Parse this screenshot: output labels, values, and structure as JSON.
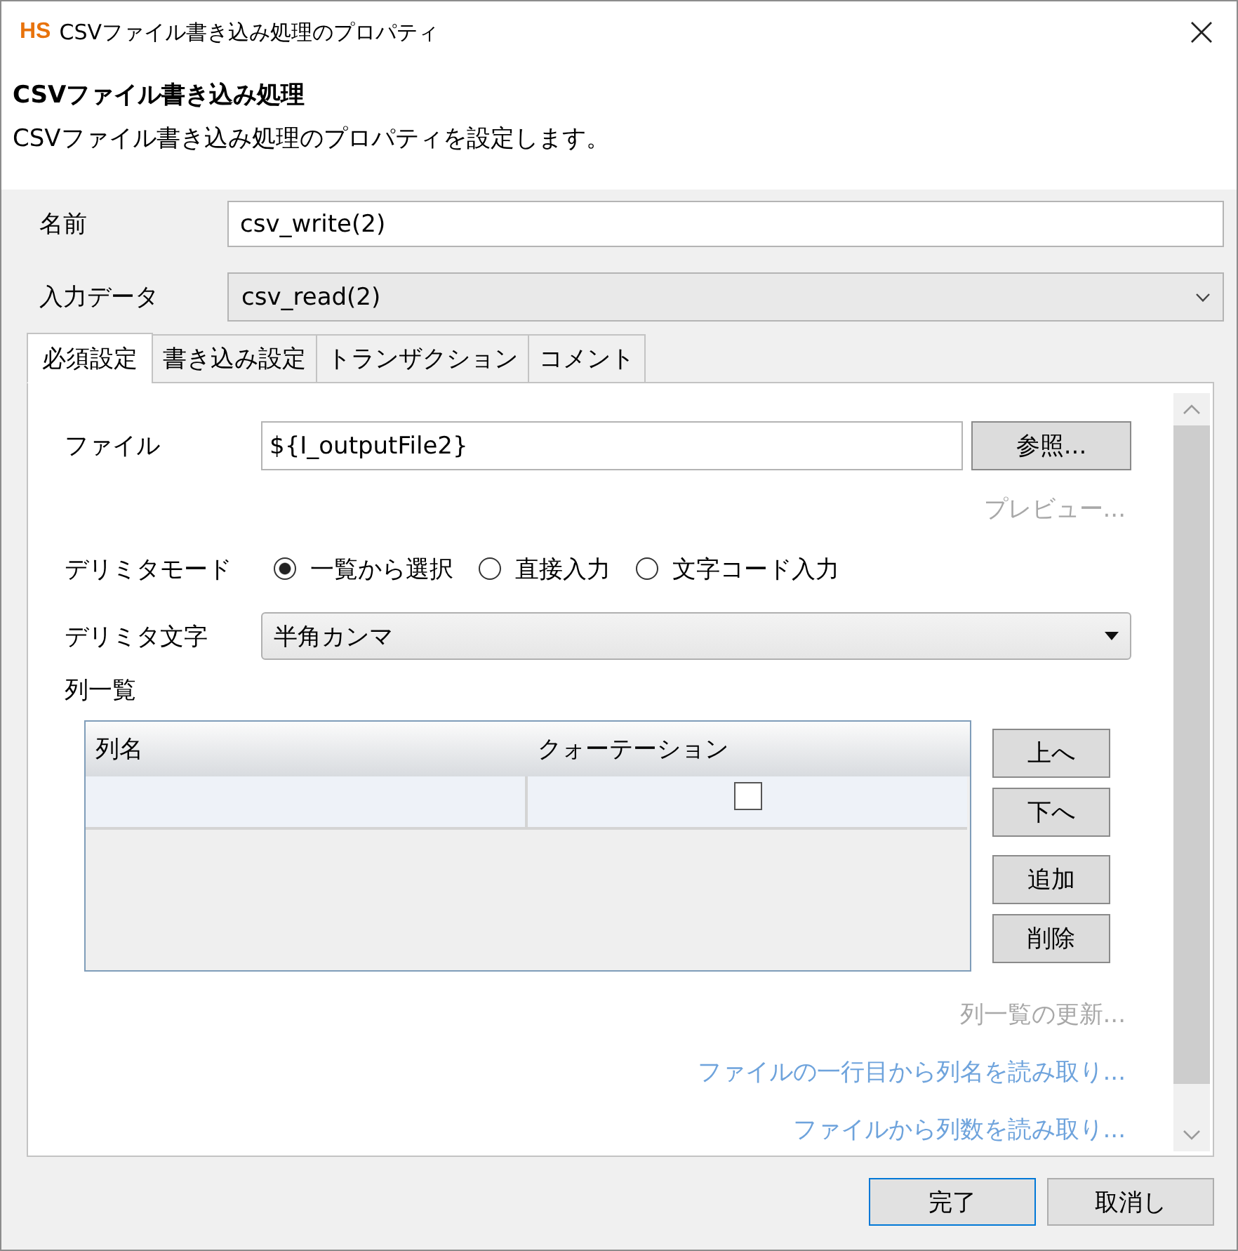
{
  "window": {
    "logo": "HS",
    "title": "CSVファイル書き込み処理のプロパティ"
  },
  "header": {
    "title": "CSVファイル書き込み処理",
    "description": "CSVファイル書き込み処理のプロパティを設定します。"
  },
  "fields": [
    {
      "kind": "text",
      "label": "名前",
      "value": "csv_write(2)"
    },
    {
      "kind": "dropdown",
      "label": "入力データ",
      "value": "csv_read(2)"
    }
  ],
  "tabs": [
    {
      "label": "必須設定",
      "selected": true
    },
    {
      "label": "書き込み設定",
      "selected": false
    },
    {
      "label": "トランザクション",
      "selected": false
    },
    {
      "label": "コメント",
      "selected": false
    }
  ],
  "required_settings": {
    "file": {
      "label": "ファイル",
      "value": "${I_outputFile2}",
      "button": "参照..."
    },
    "preview_link": {
      "label": "プレビュー...",
      "disabled": true
    },
    "delimiter_mode": {
      "label": "デリミタモード",
      "options": [
        {
          "label": "一覧から選択",
          "selected": true
        },
        {
          "label": "直接入力",
          "selected": false
        },
        {
          "label": "文字コード入力",
          "selected": false
        }
      ]
    },
    "delimiter_char": {
      "label": "デリミタ文字",
      "value": "半角カンマ"
    },
    "column_list": {
      "label": "列一覧",
      "columns": [
        "列名",
        "クォーテーション"
      ],
      "rows": [
        {
          "quoted": false
        }
      ],
      "button_groups": [
        [
          "上へ",
          "下へ"
        ],
        [
          "追加",
          "削除"
        ]
      ]
    },
    "links": [
      {
        "label": "列一覧の更新...",
        "disabled": true
      },
      {
        "label": "ファイルの一行目から列名を読み取り...",
        "disabled": false
      },
      {
        "label": "ファイルから列数を読み取り...",
        "disabled": false
      }
    ]
  },
  "buttons": [
    {
      "label": "完了",
      "default": true
    },
    {
      "label": "取消し",
      "default": false
    }
  ]
}
